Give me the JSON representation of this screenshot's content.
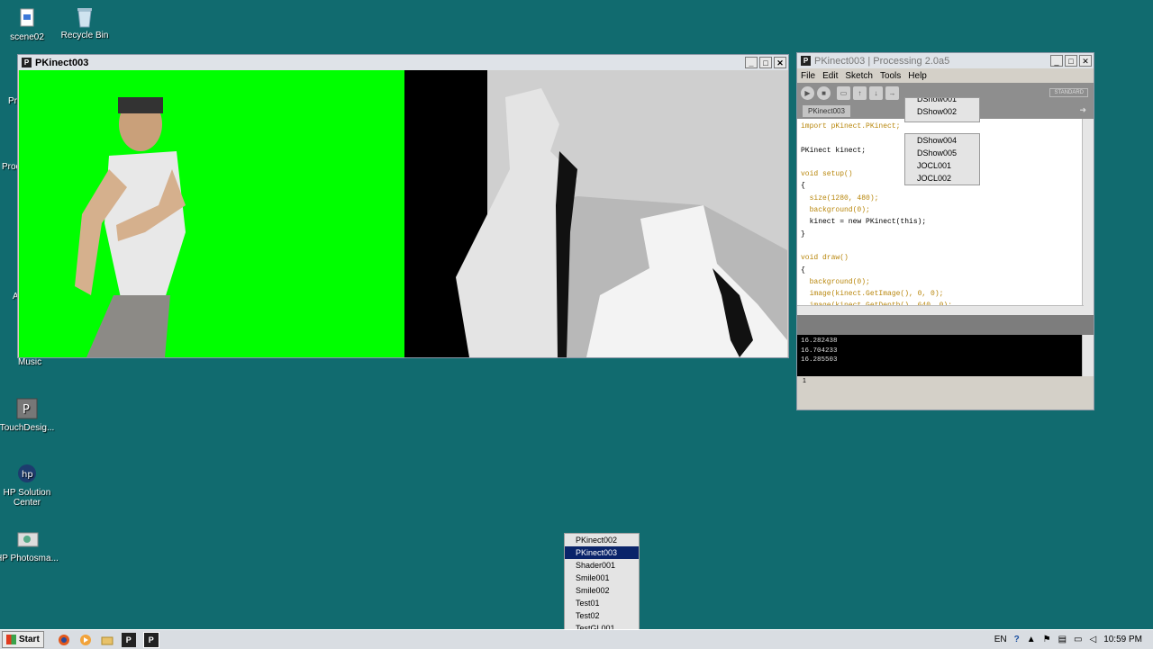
{
  "desktop": {
    "icons": [
      {
        "label": "scene02"
      },
      {
        "label": "Recycle Bin"
      },
      {
        "label": "TouchDesig..."
      },
      {
        "label": "HP Solution Center"
      },
      {
        "label": "HP Photosma..."
      }
    ],
    "partial_labels": [
      "Pr",
      "Proc",
      "A",
      "Music"
    ]
  },
  "sketch_window": {
    "title": "PKinect003"
  },
  "ide_window": {
    "title": "PKinect003 | Processing 2.0a5",
    "menu": [
      "File",
      "Edit",
      "Sketch",
      "Tools",
      "Help"
    ],
    "mode": "STANDARD",
    "tab": "PKinect003",
    "code_lines": [
      "import pKinect.PKinect;",
      "",
      "PKinect kinect;",
      "",
      "void setup()",
      "{",
      "  size(1280, 480);",
      "  background(0);",
      "  kinect = new PKinect(this);",
      "}",
      "",
      "void draw()",
      "{",
      "  background(0);",
      "  image(kinect.GetImage(), 0, 0);",
      "  image(kinect.GetDepth(), 640, 0);",
      "}"
    ],
    "console_lines": [
      "16.282438",
      "16.704233",
      "16.285503"
    ],
    "status_line": "1",
    "sketchbook_menu": [
      "DShow001",
      "DShow002",
      "DShow004",
      "DShow005",
      "JOCL001",
      "JOCL002"
    ]
  },
  "taskbar_popup": {
    "items": [
      "PKinect002",
      "PKinect003",
      "Shader001",
      "Smile001",
      "Smile002",
      "Test01",
      "Test02",
      "TestGL001"
    ],
    "selected": "PKinect003"
  },
  "taskbar": {
    "start": "Start",
    "language": "EN",
    "clock": "10:59 PM"
  },
  "colors": {
    "desktop": "#116b6f",
    "green_screen": "#00ff00",
    "selection": "#0a246a"
  }
}
